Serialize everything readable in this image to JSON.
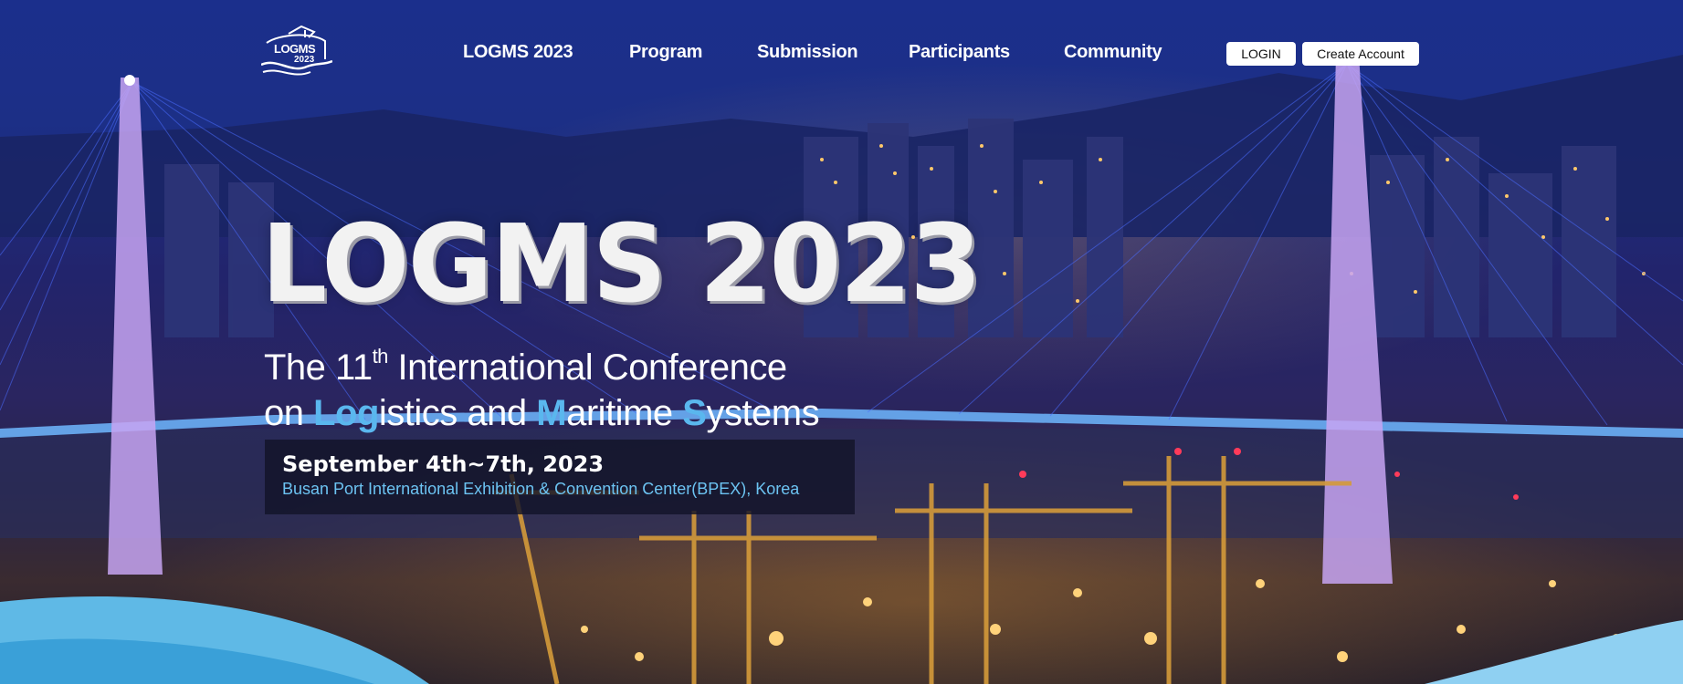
{
  "logo": {
    "line1": "LOGMS",
    "line2": "2023"
  },
  "nav": {
    "items": [
      {
        "label": "LOGMS 2023"
      },
      {
        "label": "Program"
      },
      {
        "label": "Submission"
      },
      {
        "label": "Participants"
      },
      {
        "label": "Community"
      }
    ]
  },
  "auth": {
    "login_label": "LOGIN",
    "create_account_label": "Create Account"
  },
  "hero": {
    "title": "LOGMS 2023",
    "subtitle": {
      "line1_prefix": "The 11",
      "line1_sup": "th",
      "line1_suffix": " International  Conference",
      "line2_prefix": "on ",
      "line2_hl1": "Log",
      "line2_part1": "istics and ",
      "line2_hl2": "M",
      "line2_part2": "aritime ",
      "line2_hl3": "S",
      "line2_part3": "ystems"
    },
    "date": "September 4th~7th, 2023",
    "venue": "Busan Port International Exhibition & Convention Center(BPEX), Korea"
  },
  "colors": {
    "accent": "#5ab7ee",
    "venue_text": "#6cc3f2",
    "wave": "#5fb9e6"
  }
}
